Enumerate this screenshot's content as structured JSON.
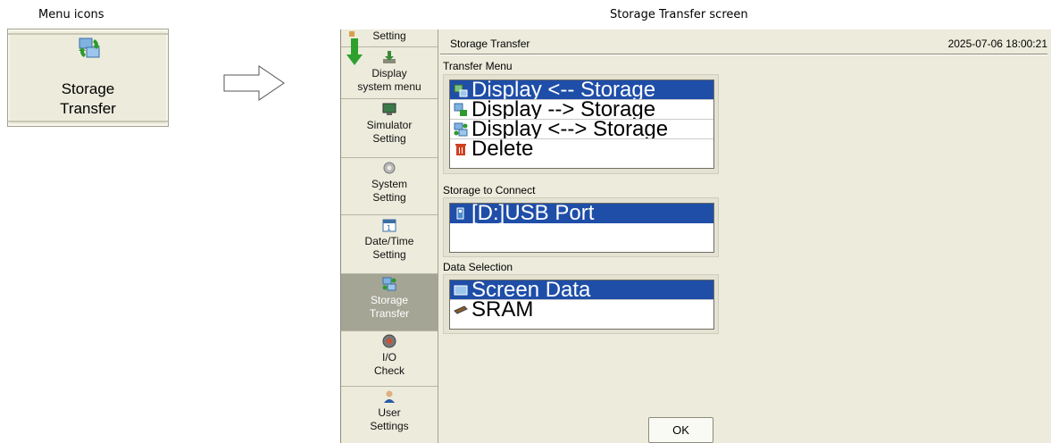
{
  "captions": {
    "menu_icons": "Menu icons",
    "screen": "Storage Transfer screen"
  },
  "menu_icon": {
    "label_line1": "Storage",
    "label_line2": "Transfer",
    "icon": "storage-transfer-icon"
  },
  "sidebar": {
    "items": [
      {
        "label1": "Setting",
        "label2": "",
        "icon": "setting-icon"
      },
      {
        "label1": "Display",
        "label2": "system menu",
        "icon": "download-icon"
      },
      {
        "label1": "Simulator",
        "label2": "Setting",
        "icon": "simulator-icon"
      },
      {
        "label1": "System",
        "label2": "Setting",
        "icon": "gear-icon"
      },
      {
        "label1": "Date/Time",
        "label2": "Setting",
        "icon": "calendar-icon"
      },
      {
        "label1": "Storage",
        "label2": "Transfer",
        "icon": "storage-transfer-icon",
        "active": true
      },
      {
        "label1": "I/O",
        "label2": "Check",
        "icon": "io-check-icon"
      },
      {
        "label1": "User",
        "label2": "Settings",
        "icon": "user-icon"
      }
    ]
  },
  "header": {
    "title": "Storage Transfer",
    "datetime": "2025-07-06 18:00:21"
  },
  "transfer_menu": {
    "label": "Transfer Menu",
    "items": [
      {
        "label": "Display <-- Storage",
        "icon": "display-from-storage-icon",
        "selected": true
      },
      {
        "label": "Display --> Storage",
        "icon": "display-to-storage-icon",
        "selected": false
      },
      {
        "label": "Display <--> Storage",
        "icon": "display-both-storage-icon",
        "selected": false
      },
      {
        "label": "Delete",
        "icon": "trash-icon",
        "selected": false
      }
    ]
  },
  "storage_to_connect": {
    "label": "Storage to Connect",
    "items": [
      {
        "label": "[D:]USB Port",
        "icon": "usb-icon",
        "selected": true
      }
    ]
  },
  "data_selection": {
    "label": "Data Selection",
    "items": [
      {
        "label": "Screen Data",
        "icon": "screen-data-icon",
        "selected": true
      },
      {
        "label": "SRAM",
        "icon": "sram-icon",
        "selected": false
      }
    ]
  },
  "ok_button": "OK",
  "colors": {
    "selection": "#1f4ea8",
    "panel": "#ecebdc",
    "active_sidebar": "#a5a596"
  }
}
